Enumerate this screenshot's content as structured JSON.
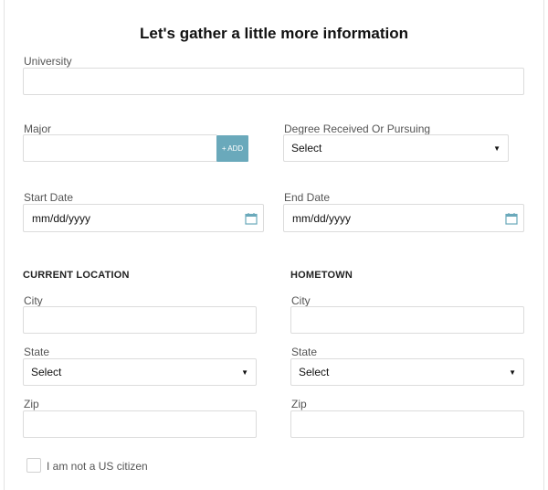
{
  "title": "Let's gather a little more information",
  "university": {
    "label": "University",
    "value": ""
  },
  "major": {
    "label": "Major",
    "value": "",
    "add_label": "+ ADD"
  },
  "degree": {
    "label": "Degree Received Or Pursuing",
    "selected": "Select"
  },
  "start_date": {
    "label": "Start Date",
    "value": "mm/dd/yyyy"
  },
  "end_date": {
    "label": "End Date",
    "value": "mm/dd/yyyy"
  },
  "current_location": {
    "heading": "CURRENT LOCATION",
    "city_label": "City",
    "city_value": "",
    "state_label": "State",
    "state_selected": "Select",
    "zip_label": "Zip",
    "zip_value": ""
  },
  "hometown": {
    "heading": "HOMETOWN",
    "city_label": "City",
    "city_value": "",
    "state_label": "State",
    "state_selected": "Select",
    "zip_label": "Zip",
    "zip_value": ""
  },
  "citizen_checkbox": {
    "label": "I am not a US citizen",
    "checked": false
  },
  "colors": {
    "accent": "#6aa9bb",
    "border": "#dcdcdc"
  },
  "icons": {
    "dropdown": "caret-down-icon",
    "date": "calendar-icon"
  }
}
